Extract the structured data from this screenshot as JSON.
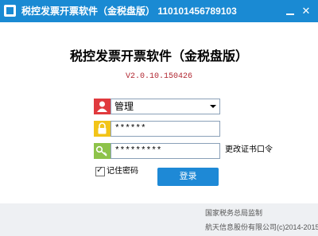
{
  "window": {
    "title": "税控发票开票软件（金税盘版） 110101456789103",
    "minimize_label": "",
    "close_label": "✕"
  },
  "login": {
    "heading": "税控发票开票软件（金税盘版）",
    "version": "V2.0.10.150426",
    "user": {
      "value": "管理"
    },
    "password": {
      "value": "******"
    },
    "cert_password": {
      "value": "*********"
    },
    "change_cert_link": "更改证书口令",
    "remember_label": "记住密码",
    "remember_checked": true,
    "login_button": "登录"
  },
  "footer": {
    "line1": "国家税务总局监制",
    "line2": "航天信息股份有限公司(c)2014-2015"
  },
  "colors": {
    "titlebar": "#1a8ad3",
    "version_text": "#b0252f",
    "login_button": "#1e89d6",
    "user_icon_bg": "#e03a3e",
    "lock_icon_bg": "#f2c418",
    "key_icon_bg": "#8ec34a"
  },
  "icons": {
    "app": "app-logo-icon",
    "user": "user-icon",
    "password": "lock-icon",
    "cert": "key-icon"
  }
}
